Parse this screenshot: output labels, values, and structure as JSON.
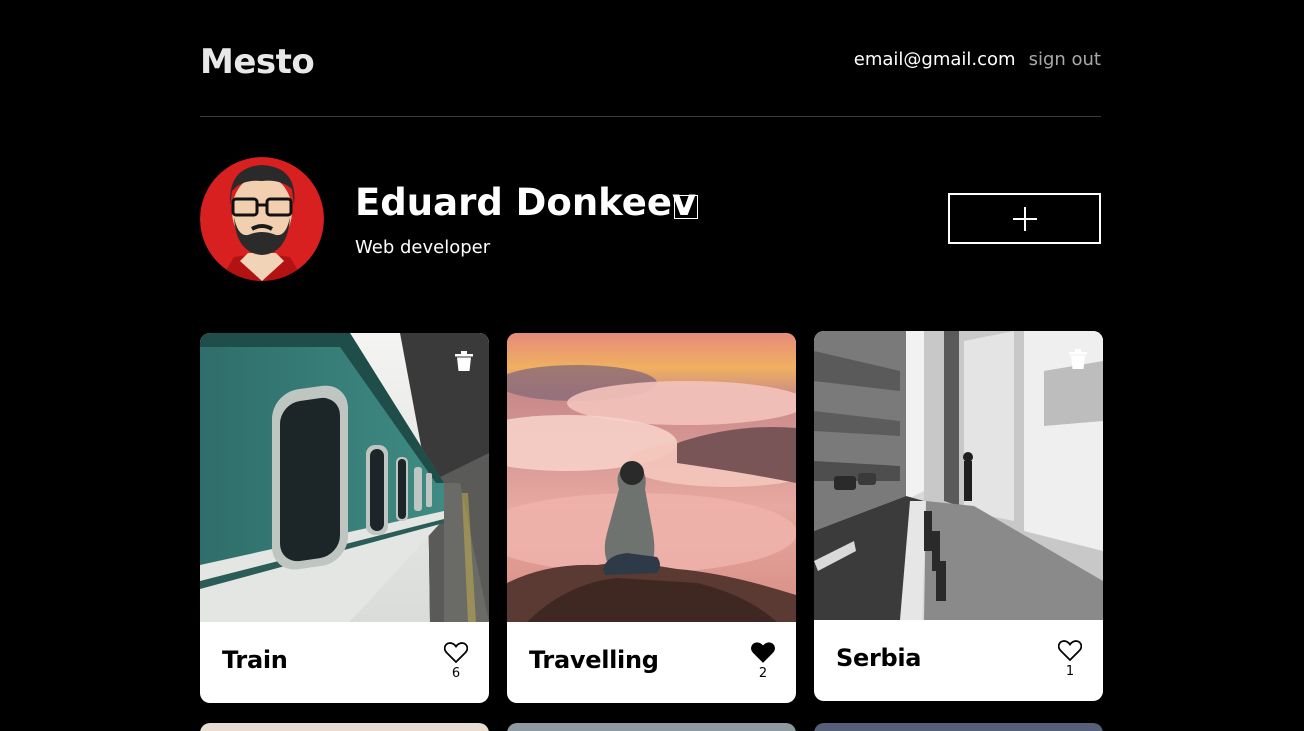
{
  "header": {
    "logo": "Mesto",
    "email": "email@gmail.com",
    "signout_label": "sign out"
  },
  "profile": {
    "name": "Eduard Donkeev",
    "about": "Web developer",
    "edit_icon": "pencil-icon",
    "add_icon": "plus-icon"
  },
  "cards": [
    {
      "title": "Train",
      "likes": "6",
      "liked": false,
      "deletable": true,
      "image": "train-photo"
    },
    {
      "title": "Travelling",
      "likes": "2",
      "liked": true,
      "deletable": false,
      "image": "clouds-photo"
    },
    {
      "title": "Serbia",
      "likes": "1",
      "liked": false,
      "deletable": true,
      "image": "street-photo"
    }
  ],
  "colors": {
    "background": "#000000",
    "card": "#ffffff",
    "signout": "#a9a9a9",
    "divider": "#545454"
  }
}
